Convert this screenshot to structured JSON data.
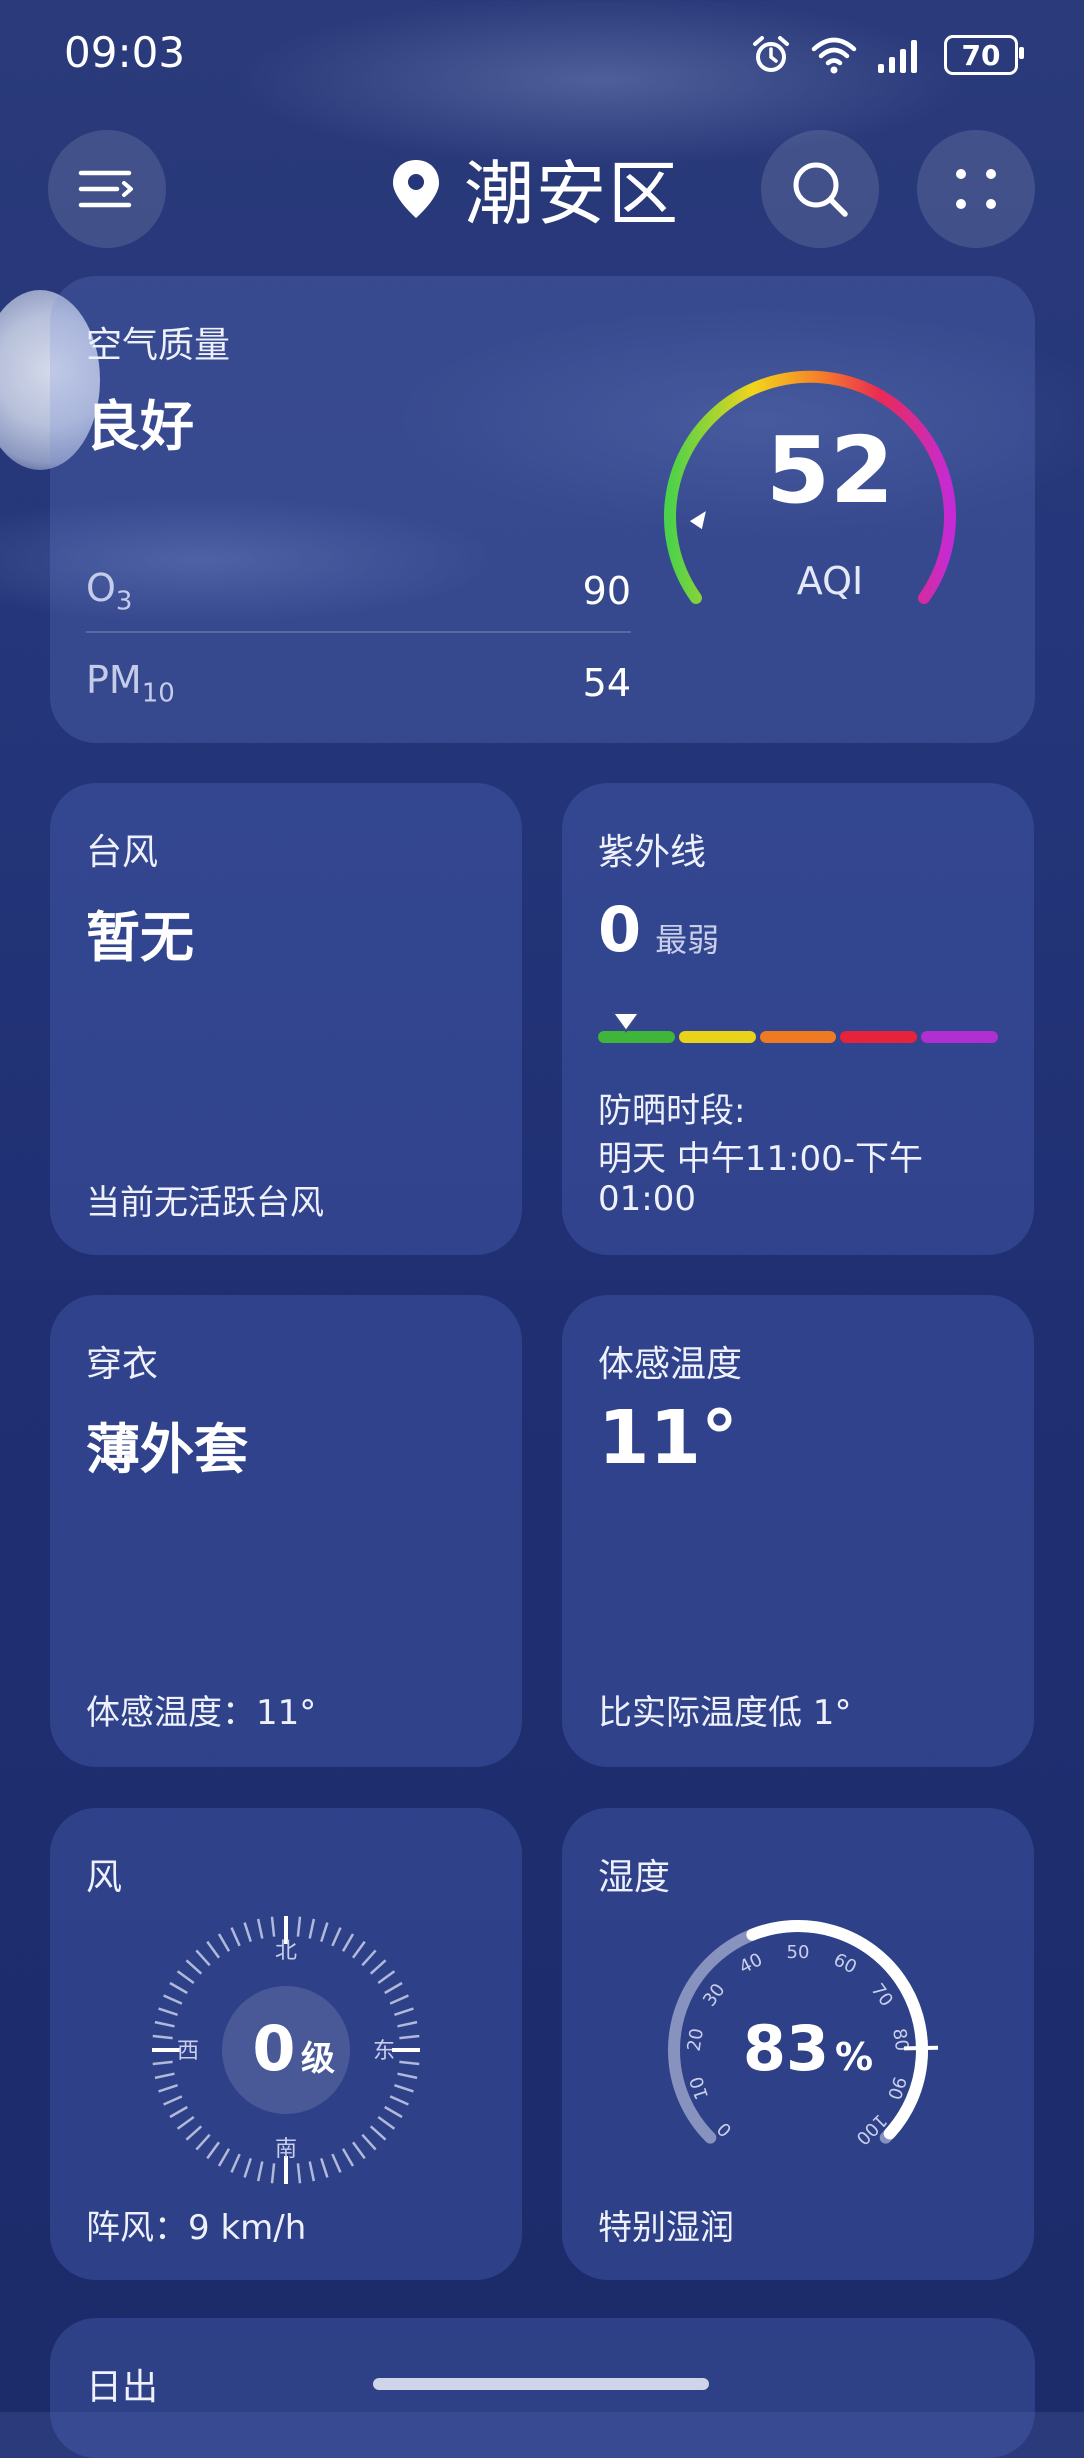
{
  "status_bar": {
    "time": "09:03",
    "battery": "70"
  },
  "header": {
    "city": "潮安区"
  },
  "air_quality": {
    "title": "空气质量",
    "level": "良好",
    "aqi_value": "52",
    "aqi_label": "AQI",
    "aqi_gauge_fraction": 0.1,
    "pollutants": [
      {
        "name": "O",
        "sub": "3",
        "value": "90"
      },
      {
        "name": "PM",
        "sub": "10",
        "value": "54"
      }
    ]
  },
  "typhoon": {
    "title": "台风",
    "value": "暂无",
    "note": "当前无活跃台风"
  },
  "uv": {
    "title": "紫外线",
    "value": "0",
    "level": "最弱",
    "scale_colors": [
      "#3fb53a",
      "#e8d21a",
      "#ef7a22",
      "#e5243c",
      "#b02fd0"
    ],
    "marker_fraction": 0.07,
    "protect_label": "防晒时段:",
    "protect_line1": "明天 中午11:00-下午",
    "protect_line2": "01:00"
  },
  "clothing": {
    "title": "穿衣",
    "value": "薄外套",
    "note": "体感温度：11°"
  },
  "feels_like": {
    "title": "体感温度",
    "value": "11°",
    "note": "比实际温度低 1°"
  },
  "wind": {
    "title": "风",
    "level_value": "0",
    "level_unit": "级",
    "north": "北",
    "south": "南",
    "west": "西",
    "east": "东",
    "gust": "阵风：9 km/h"
  },
  "humidity": {
    "title": "湿度",
    "value": "83",
    "unit": "%",
    "note": "特别湿润",
    "ticks": [
      "0",
      "10",
      "20",
      "30",
      "40",
      "50",
      "60",
      "70",
      "80",
      "90",
      "100"
    ],
    "fraction": 0.83
  },
  "sunrise": {
    "title": "日出"
  }
}
